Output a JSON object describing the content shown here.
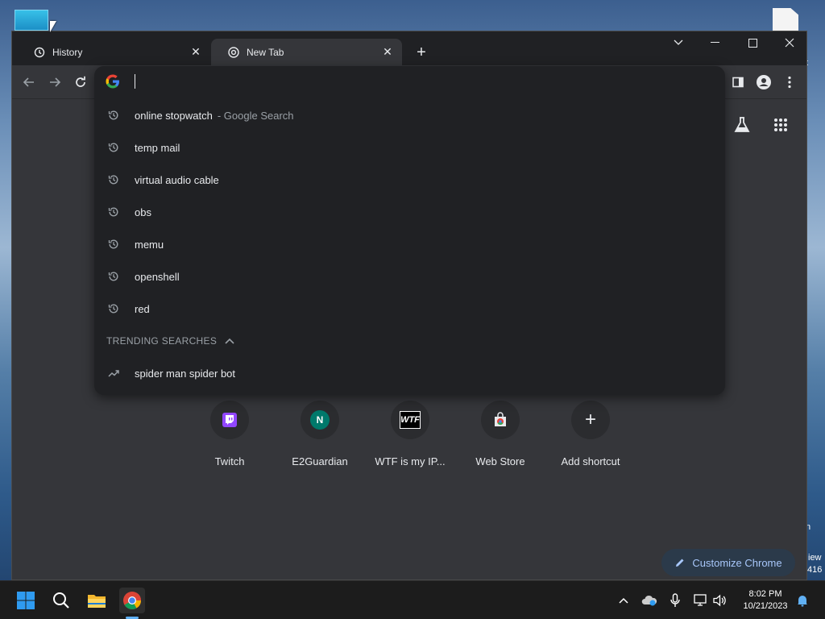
{
  "desktop": {
    "frag_t": "t",
    "frag_n": "n",
    "frag_iew": "iew",
    "frag_416": "416"
  },
  "tabs": [
    {
      "label": "History",
      "close": "✕"
    },
    {
      "label": "New Tab",
      "close": "✕"
    }
  ],
  "newtab_symbol": "+",
  "omnibox": {
    "suggestions": [
      {
        "text": "online stopwatch",
        "sub": "- Google Search",
        "icon": "history-icon"
      },
      {
        "text": "temp mail",
        "sub": "",
        "icon": "history-icon"
      },
      {
        "text": "virtual audio cable",
        "sub": "",
        "icon": "history-icon"
      },
      {
        "text": "obs",
        "sub": "",
        "icon": "history-icon"
      },
      {
        "text": "memu",
        "sub": "",
        "icon": "history-icon"
      },
      {
        "text": "openshell",
        "sub": "",
        "icon": "history-icon"
      },
      {
        "text": "red",
        "sub": "",
        "icon": "history-icon"
      }
    ],
    "trending_header": "TRENDING SEARCHES",
    "trending": [
      {
        "text": "spider man spider bot",
        "icon": "trending-icon"
      }
    ]
  },
  "shortcuts": [
    {
      "label": "Twitch",
      "glyph": ""
    },
    {
      "label": "E2Guardian",
      "glyph": "N"
    },
    {
      "label": "WTF is my IP...",
      "glyph": "WTF"
    },
    {
      "label": "Web Store",
      "glyph": ""
    },
    {
      "label": "Add shortcut",
      "glyph": "+"
    }
  ],
  "customize_label": "Customize Chrome",
  "taskbar": {
    "time": "8:02 PM",
    "date": "10/21/2023"
  },
  "colors": {
    "accent": "#a8c7fa",
    "twitch": "#9146ff",
    "e2guardian": "#00796b"
  }
}
